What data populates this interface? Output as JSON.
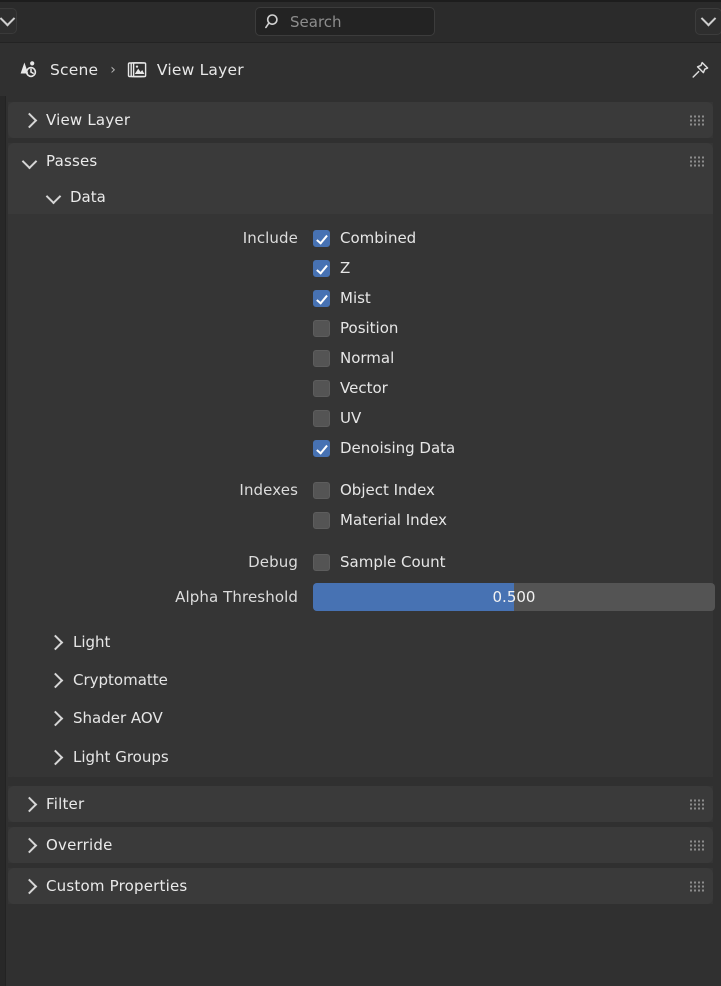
{
  "topbar": {
    "left_dropdown_icon": "chevron-down-icon",
    "right_dropdown_icon": "chevron-down-icon",
    "search": {
      "icon": "search-icon",
      "value": "",
      "placeholder": "Search"
    }
  },
  "breadcrumb": {
    "scene_icon": "scene-icon",
    "scene_label": "Scene",
    "separator": "›",
    "viewlayer_icon": "view-layer-images-icon",
    "viewlayer_label": "View Layer",
    "pin_icon": "pin-icon"
  },
  "panels": [
    {
      "id": "view-layer",
      "title": "View Layer",
      "expanded": false,
      "grip_icon": "drag-grip-icon"
    },
    {
      "id": "passes",
      "title": "Passes",
      "expanded": true,
      "grip_icon": "drag-grip-icon"
    },
    {
      "id": "filter",
      "title": "Filter",
      "expanded": false,
      "grip_icon": "drag-grip-icon"
    },
    {
      "id": "override",
      "title": "Override",
      "expanded": false,
      "grip_icon": "drag-grip-icon"
    },
    {
      "id": "custom-properties",
      "title": "Custom Properties",
      "expanded": false,
      "grip_icon": "drag-grip-icon"
    }
  ],
  "passes": {
    "data_subpanel": {
      "title": "Data",
      "expanded": true,
      "groups": [
        {
          "label": "Include",
          "items": [
            {
              "label": "Combined",
              "checked": true
            },
            {
              "label": "Z",
              "checked": true
            },
            {
              "label": "Mist",
              "checked": true
            },
            {
              "label": "Position",
              "checked": false
            },
            {
              "label": "Normal",
              "checked": false
            },
            {
              "label": "Vector",
              "checked": false
            },
            {
              "label": "UV",
              "checked": false
            },
            {
              "label": "Denoising Data",
              "checked": true
            }
          ]
        },
        {
          "label": "Indexes",
          "items": [
            {
              "label": "Object Index",
              "checked": false
            },
            {
              "label": "Material Index",
              "checked": false
            }
          ]
        },
        {
          "label": "Debug",
          "items": [
            {
              "label": "Sample Count",
              "checked": false
            }
          ]
        }
      ],
      "slider": {
        "label": "Alpha Threshold",
        "value": "0.500",
        "fill_percent": 50
      }
    },
    "subpanels": [
      {
        "title": "Light",
        "expanded": false
      },
      {
        "title": "Cryptomatte",
        "expanded": false
      },
      {
        "title": "Shader AOV",
        "expanded": false
      },
      {
        "title": "Light Groups",
        "expanded": false
      }
    ]
  },
  "colors": {
    "background": "#303030",
    "panel": "#353535",
    "panel_header": "#3a3a3a",
    "accent_blue": "#4772b3",
    "checkbox_off": "#545454",
    "text": "#e6e6e6"
  }
}
